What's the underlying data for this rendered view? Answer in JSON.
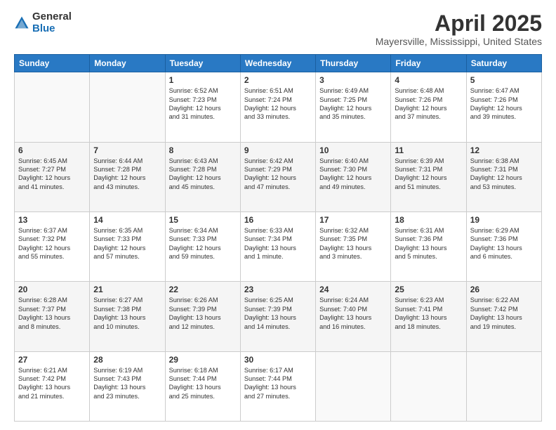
{
  "logo": {
    "general": "General",
    "blue": "Blue"
  },
  "header": {
    "title": "April 2025",
    "location": "Mayersville, Mississippi, United States"
  },
  "weekdays": [
    "Sunday",
    "Monday",
    "Tuesday",
    "Wednesday",
    "Thursday",
    "Friday",
    "Saturday"
  ],
  "weeks": [
    [
      {
        "day": "",
        "content": ""
      },
      {
        "day": "",
        "content": ""
      },
      {
        "day": "1",
        "content": "Sunrise: 6:52 AM\nSunset: 7:23 PM\nDaylight: 12 hours\nand 31 minutes."
      },
      {
        "day": "2",
        "content": "Sunrise: 6:51 AM\nSunset: 7:24 PM\nDaylight: 12 hours\nand 33 minutes."
      },
      {
        "day": "3",
        "content": "Sunrise: 6:49 AM\nSunset: 7:25 PM\nDaylight: 12 hours\nand 35 minutes."
      },
      {
        "day": "4",
        "content": "Sunrise: 6:48 AM\nSunset: 7:26 PM\nDaylight: 12 hours\nand 37 minutes."
      },
      {
        "day": "5",
        "content": "Sunrise: 6:47 AM\nSunset: 7:26 PM\nDaylight: 12 hours\nand 39 minutes."
      }
    ],
    [
      {
        "day": "6",
        "content": "Sunrise: 6:45 AM\nSunset: 7:27 PM\nDaylight: 12 hours\nand 41 minutes."
      },
      {
        "day": "7",
        "content": "Sunrise: 6:44 AM\nSunset: 7:28 PM\nDaylight: 12 hours\nand 43 minutes."
      },
      {
        "day": "8",
        "content": "Sunrise: 6:43 AM\nSunset: 7:28 PM\nDaylight: 12 hours\nand 45 minutes."
      },
      {
        "day": "9",
        "content": "Sunrise: 6:42 AM\nSunset: 7:29 PM\nDaylight: 12 hours\nand 47 minutes."
      },
      {
        "day": "10",
        "content": "Sunrise: 6:40 AM\nSunset: 7:30 PM\nDaylight: 12 hours\nand 49 minutes."
      },
      {
        "day": "11",
        "content": "Sunrise: 6:39 AM\nSunset: 7:31 PM\nDaylight: 12 hours\nand 51 minutes."
      },
      {
        "day": "12",
        "content": "Sunrise: 6:38 AM\nSunset: 7:31 PM\nDaylight: 12 hours\nand 53 minutes."
      }
    ],
    [
      {
        "day": "13",
        "content": "Sunrise: 6:37 AM\nSunset: 7:32 PM\nDaylight: 12 hours\nand 55 minutes."
      },
      {
        "day": "14",
        "content": "Sunrise: 6:35 AM\nSunset: 7:33 PM\nDaylight: 12 hours\nand 57 minutes."
      },
      {
        "day": "15",
        "content": "Sunrise: 6:34 AM\nSunset: 7:33 PM\nDaylight: 12 hours\nand 59 minutes."
      },
      {
        "day": "16",
        "content": "Sunrise: 6:33 AM\nSunset: 7:34 PM\nDaylight: 13 hours\nand 1 minute."
      },
      {
        "day": "17",
        "content": "Sunrise: 6:32 AM\nSunset: 7:35 PM\nDaylight: 13 hours\nand 3 minutes."
      },
      {
        "day": "18",
        "content": "Sunrise: 6:31 AM\nSunset: 7:36 PM\nDaylight: 13 hours\nand 5 minutes."
      },
      {
        "day": "19",
        "content": "Sunrise: 6:29 AM\nSunset: 7:36 PM\nDaylight: 13 hours\nand 6 minutes."
      }
    ],
    [
      {
        "day": "20",
        "content": "Sunrise: 6:28 AM\nSunset: 7:37 PM\nDaylight: 13 hours\nand 8 minutes."
      },
      {
        "day": "21",
        "content": "Sunrise: 6:27 AM\nSunset: 7:38 PM\nDaylight: 13 hours\nand 10 minutes."
      },
      {
        "day": "22",
        "content": "Sunrise: 6:26 AM\nSunset: 7:39 PM\nDaylight: 13 hours\nand 12 minutes."
      },
      {
        "day": "23",
        "content": "Sunrise: 6:25 AM\nSunset: 7:39 PM\nDaylight: 13 hours\nand 14 minutes."
      },
      {
        "day": "24",
        "content": "Sunrise: 6:24 AM\nSunset: 7:40 PM\nDaylight: 13 hours\nand 16 minutes."
      },
      {
        "day": "25",
        "content": "Sunrise: 6:23 AM\nSunset: 7:41 PM\nDaylight: 13 hours\nand 18 minutes."
      },
      {
        "day": "26",
        "content": "Sunrise: 6:22 AM\nSunset: 7:42 PM\nDaylight: 13 hours\nand 19 minutes."
      }
    ],
    [
      {
        "day": "27",
        "content": "Sunrise: 6:21 AM\nSunset: 7:42 PM\nDaylight: 13 hours\nand 21 minutes."
      },
      {
        "day": "28",
        "content": "Sunrise: 6:19 AM\nSunset: 7:43 PM\nDaylight: 13 hours\nand 23 minutes."
      },
      {
        "day": "29",
        "content": "Sunrise: 6:18 AM\nSunset: 7:44 PM\nDaylight: 13 hours\nand 25 minutes."
      },
      {
        "day": "30",
        "content": "Sunrise: 6:17 AM\nSunset: 7:44 PM\nDaylight: 13 hours\nand 27 minutes."
      },
      {
        "day": "",
        "content": ""
      },
      {
        "day": "",
        "content": ""
      },
      {
        "day": "",
        "content": ""
      }
    ]
  ]
}
